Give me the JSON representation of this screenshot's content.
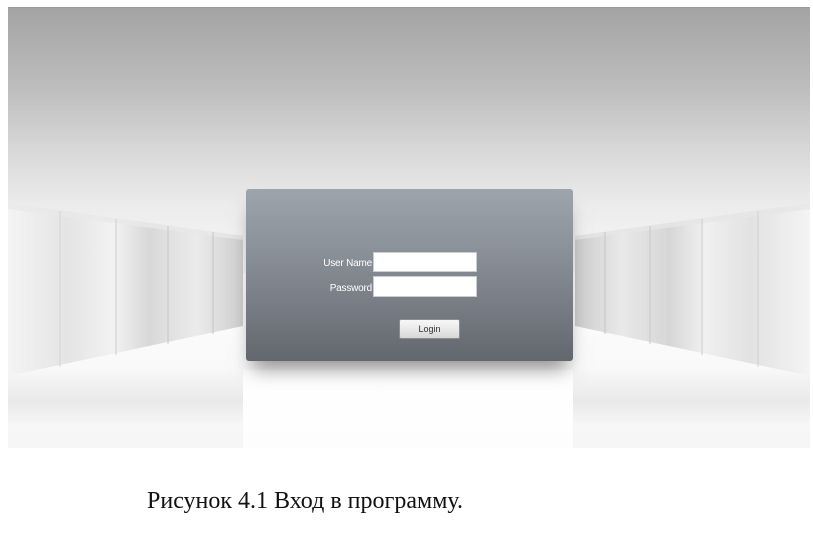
{
  "login_form": {
    "username_label": "User Name",
    "password_label": "Password",
    "username_value": "",
    "password_value": "",
    "login_button": "Login"
  },
  "caption": "Рисунок 4.1 Вход в программу.",
  "colors": {
    "panel_top": "#9ea4ab",
    "panel_bottom": "#62666d",
    "label_text": "#ffffff"
  }
}
